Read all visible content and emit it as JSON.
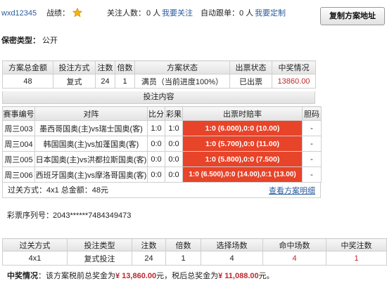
{
  "header": {
    "username": "wxd12345",
    "record_label": "战绩：",
    "followers_label": "关注人数：",
    "followers_value": "0 人",
    "follow_link": "我要关注",
    "autofollow_label": "自动跟单：",
    "autofollow_value": "0 人",
    "custom_link": "我要定制",
    "copy_button": "复制方案地址"
  },
  "privacy": {
    "label": "保密类型：",
    "value": "公开"
  },
  "summary": {
    "headers": [
      "方案总金额",
      "投注方式",
      "注数",
      "倍数",
      "方案状态",
      "出票状态",
      "中奖情况"
    ],
    "values": [
      "48",
      "复式",
      "24",
      "1",
      "满员（当前进度100%）",
      "已出票",
      "13860.00"
    ]
  },
  "bet_content": {
    "title": "投注内容",
    "headers": [
      "赛事编号",
      "对阵",
      "比分",
      "彩果",
      "出票时赔率",
      "胆码"
    ],
    "rows": [
      {
        "id": "周三003",
        "match": "墨西哥国奥(主)vs瑞士国奥(客)",
        "score": "1:0",
        "result": "1:0",
        "odds": "1:0 (6.000),0:0 (10.00)",
        "banker": "-"
      },
      {
        "id": "周三004",
        "match": "韩国国奥(主)vs加蓬国奥(客)",
        "score": "0:0",
        "result": "0:0",
        "odds": "1:0 (5.700),0:0 (11.00)",
        "banker": "-"
      },
      {
        "id": "周三005",
        "match": "日本国奥(主)vs洪都拉斯国奥(客)",
        "score": "0:0",
        "result": "0:0",
        "odds": "1:0 (5.800),0:0 (7.500)",
        "banker": "-"
      },
      {
        "id": "周三006",
        "match": "西班牙国奥(主)vs摩洛哥国奥(客)",
        "score": "0:0",
        "result": "0:0",
        "odds": "1:0 (6.500),0:0 (14.00),0:1 (13.00)",
        "banker": "-"
      }
    ],
    "footer_text": "过关方式：4x1 总金额：48元",
    "detail_link": "查看方案明细"
  },
  "serial": {
    "label": "彩票序列号：",
    "value": "2043******7484349473"
  },
  "result": {
    "headers": [
      "过关方式",
      "投注类型",
      "注数",
      "倍数",
      "选择场数",
      "命中场数",
      "中奖注数"
    ],
    "values": [
      "4x1",
      "复式投注",
      "24",
      "1",
      "4",
      "4",
      "1"
    ]
  },
  "prize": {
    "label": "中奖情况",
    "text1": "：该方案税前总奖金为",
    "pre_tax": "¥ 13,860.00",
    "text2": "元，税后总奖金为",
    "post_tax": "¥ 11,088.00",
    "text3": "元。"
  },
  "colors": {
    "accent_red": "#c0272d",
    "odds_bg": "#e7442a",
    "link": "#2b5c9c"
  }
}
